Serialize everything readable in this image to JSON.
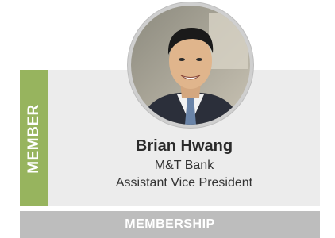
{
  "member_card": {
    "side_label": "MEMBER",
    "name": "Brian Hwang",
    "company": "M&T Bank",
    "title": "Assistant Vice President"
  },
  "footer": {
    "label": "MEMBERSHIP"
  },
  "colors": {
    "side_tab": "#97b45e",
    "card_bg": "#ececec",
    "footer_bg": "#bdbdbd"
  }
}
